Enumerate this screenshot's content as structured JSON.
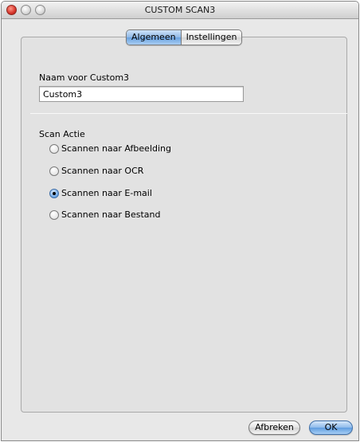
{
  "window": {
    "title": "CUSTOM SCAN3"
  },
  "tabs": [
    {
      "label": "Algemeen",
      "active": true
    },
    {
      "label": "Instellingen",
      "active": false
    }
  ],
  "name_field": {
    "label": "Naam voor Custom3",
    "value": "Custom3"
  },
  "scan_action": {
    "label": "Scan Actie",
    "options": [
      {
        "label": "Scannen naar Afbeelding",
        "selected": false
      },
      {
        "label": "Scannen naar OCR",
        "selected": false
      },
      {
        "label": "Scannen naar E-mail",
        "selected": true
      },
      {
        "label": "Scannen naar Bestand",
        "selected": false
      }
    ]
  },
  "buttons": {
    "cancel_label": "Afbreken",
    "ok_label": "OK"
  },
  "colors": {
    "accent": "#6aa2e0",
    "close_button": "#d6332a"
  }
}
